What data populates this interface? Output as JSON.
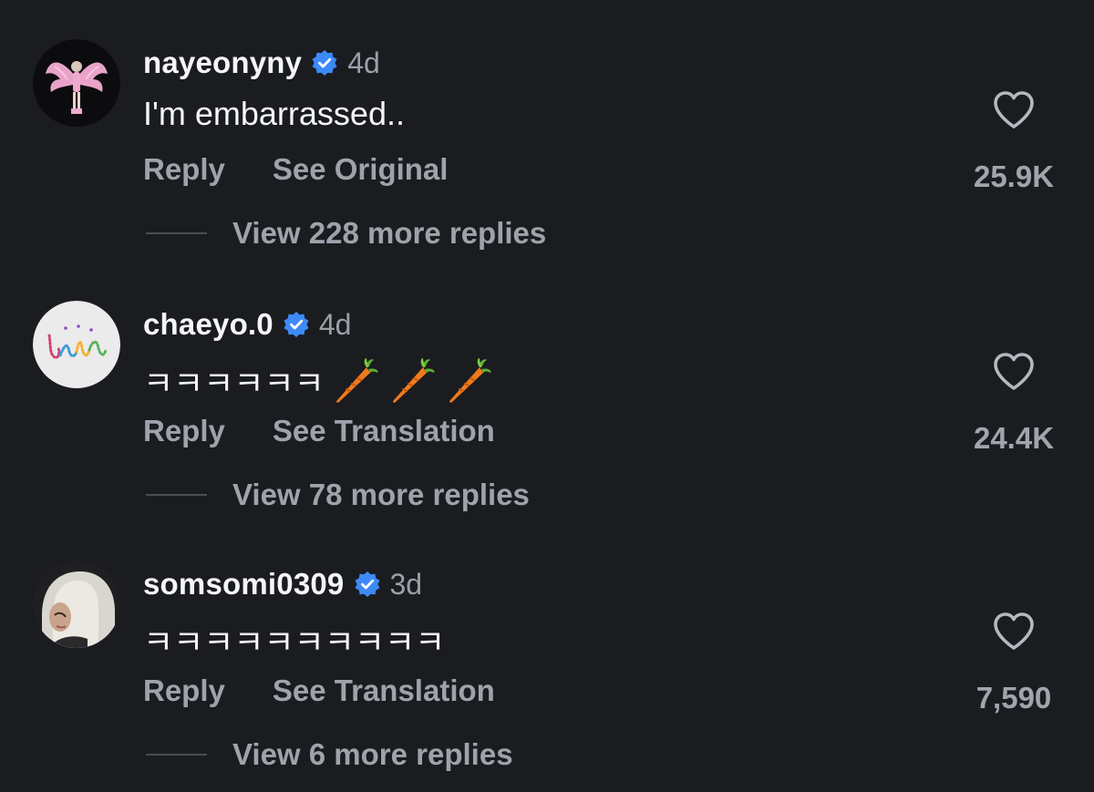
{
  "comments": [
    {
      "username": "nayeonyny",
      "time": "4d",
      "text": "I'm embarrassed..",
      "emoji": "",
      "reply_label": "Reply",
      "secondary_label": "See Original",
      "likes": "25.9K",
      "view_replies": "View 228 more replies",
      "avatar": "pink-wings-avatar"
    },
    {
      "username": "chaeyo.0",
      "time": "4d",
      "text": "ㅋㅋㅋㅋㅋㅋ",
      "emoji": "🥕🥕🥕",
      "reply_label": "Reply",
      "secondary_label": "See Translation",
      "likes": "24.4K",
      "view_replies": "View 78 more replies",
      "avatar": "beaded-lettering-avatar"
    },
    {
      "username": "somsomi0309",
      "time": "3d",
      "text": "ㅋㅋㅋㅋㅋㅋㅋㅋㅋㅋ",
      "emoji": "",
      "reply_label": "Reply",
      "secondary_label": "See Translation",
      "likes": "7,590",
      "view_replies": "View 6 more replies",
      "avatar": "blonde-hair-avatar"
    }
  ],
  "icons": {
    "verified": "verified-badge-icon",
    "like": "heart-outline-icon",
    "carrot": "carrot-icon"
  },
  "colors": {
    "background": "#1a1c20",
    "verified": "#3d8af7",
    "secondary_text": "#9ea3ab"
  }
}
